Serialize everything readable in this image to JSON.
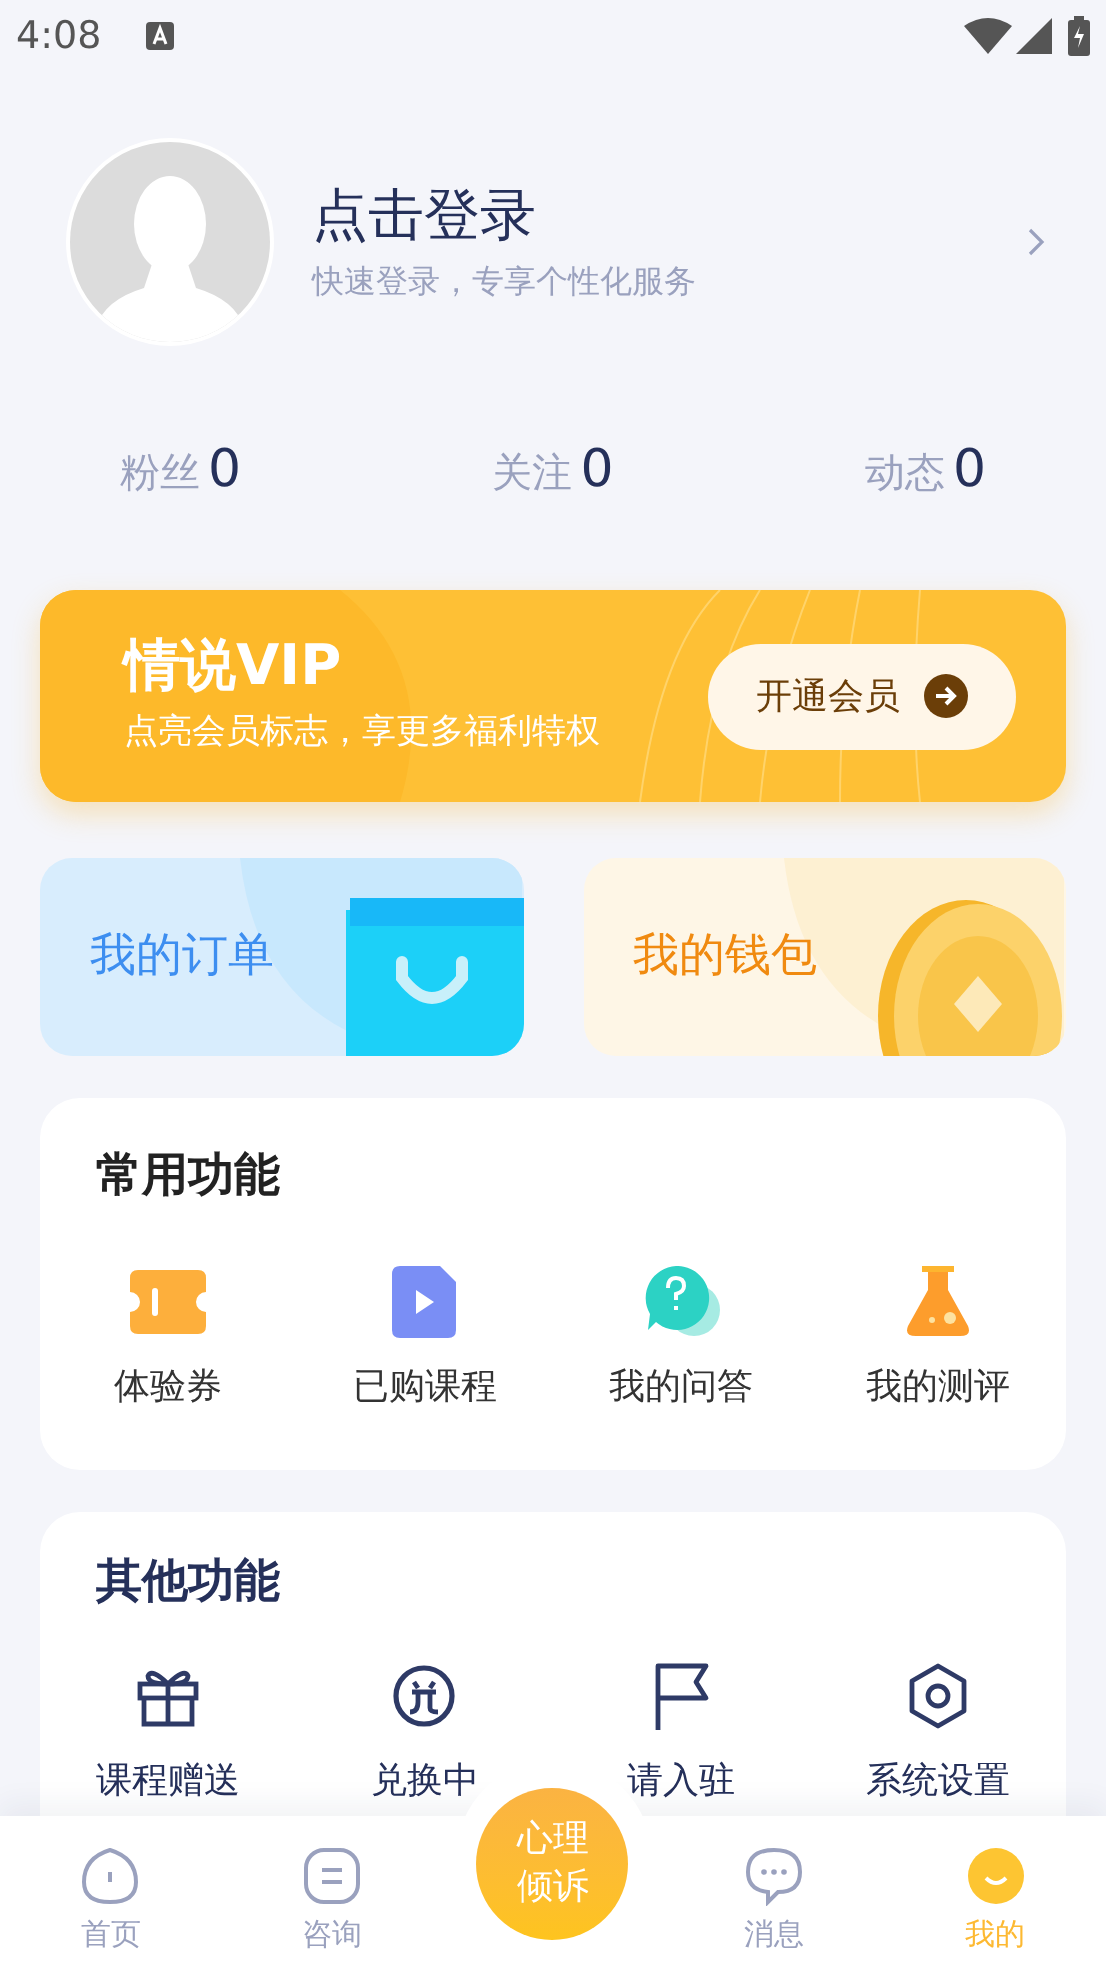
{
  "status_bar": {
    "time": "4:08"
  },
  "profile": {
    "title": "点击登录",
    "subtitle": "快速登录，专享个性化服务"
  },
  "stats": [
    {
      "label": "粉丝",
      "value": "0"
    },
    {
      "label": "关注",
      "value": "0"
    },
    {
      "label": "动态",
      "value": "0"
    }
  ],
  "vip": {
    "title": "情说VIP",
    "subtitle": "点亮会员标志，享更多福利特权",
    "button": "开通会员"
  },
  "quick_cards": [
    {
      "label": "我的订单",
      "kind": "order"
    },
    {
      "label": "我的钱包",
      "kind": "wallet"
    }
  ],
  "sections": [
    {
      "title": "常用功能",
      "items": [
        {
          "label": "体验券",
          "kind": "ticket"
        },
        {
          "label": "已购课程",
          "kind": "video"
        },
        {
          "label": "我的问答",
          "kind": "qa"
        },
        {
          "label": "我的测评",
          "kind": "flask"
        }
      ]
    },
    {
      "title": "其他功能",
      "items": [
        {
          "label": "课程赠送",
          "kind": "gift"
        },
        {
          "label": "兑换中",
          "kind": "exchange"
        },
        {
          "label": "请入驻",
          "kind": "flag"
        },
        {
          "label": "系统设置",
          "kind": "settings"
        }
      ]
    }
  ],
  "center_button": {
    "label": "心理倾诉"
  },
  "tabs": [
    {
      "label": "首页",
      "kind": "home",
      "selected": false
    },
    {
      "label": "咨询",
      "kind": "consult",
      "selected": false
    },
    {
      "label": "消息",
      "kind": "message",
      "selected": false
    },
    {
      "label": "我的",
      "kind": "me",
      "selected": true
    }
  ]
}
